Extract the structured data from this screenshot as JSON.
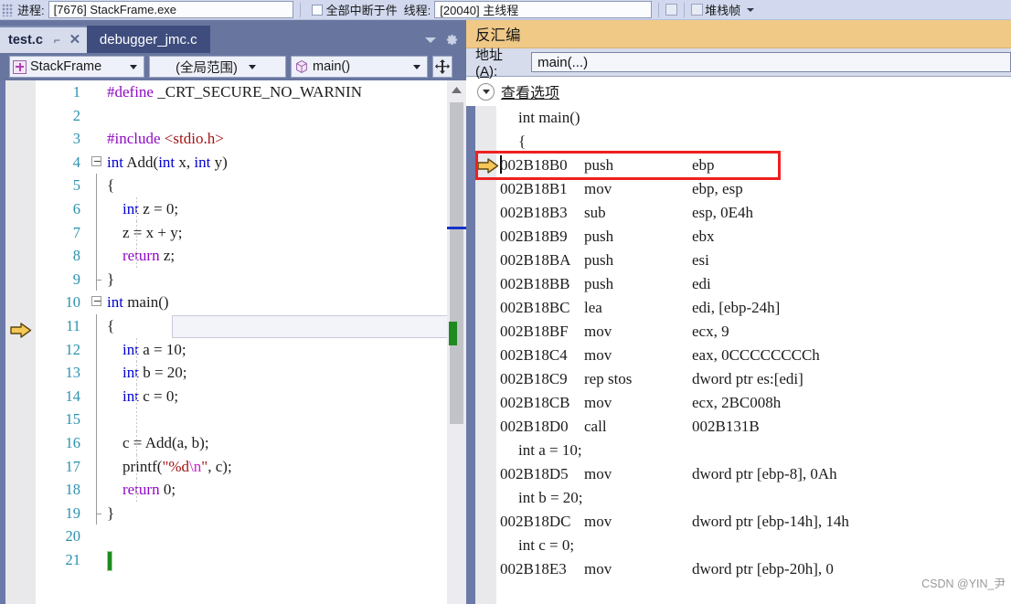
{
  "top_toolbar": {
    "process_label": "进程:",
    "process_value": "[7676] StackFrame.exe",
    "break_all_label": "全部中断于件",
    "thread_label": "线程:",
    "thread_value": "[20040] 主线程",
    "stackframe_label": "堆栈帧"
  },
  "editor": {
    "tabs": [
      {
        "name": "test.c",
        "active": true,
        "pin_icon": "pin-icon",
        "close_icon": "close-icon"
      },
      {
        "name": "debugger_jmc.c",
        "active": false
      }
    ],
    "tab_overflow_icon": "chevron-down-icon",
    "tab_settings_icon": "gear-icon",
    "navbar": {
      "project": "StackFrame",
      "scope": "(全局范围)",
      "member": "main()",
      "splitter_icon": "split-window-icon"
    },
    "current_line": 11,
    "execution_arrow_line": 11,
    "lines": [
      {
        "n": 1,
        "segments": [
          {
            "t": "#define",
            "c": "k-pre"
          },
          {
            "t": " _CRT_SECURE_NO_WARNIN",
            "c": "k-plain"
          }
        ],
        "indent": 4,
        "fold": "none"
      },
      {
        "n": 2,
        "segments": [],
        "indent": 0,
        "fold": "none"
      },
      {
        "n": 3,
        "segments": [
          {
            "t": "#include",
            "c": "k-pre"
          },
          {
            "t": " ",
            "c": "k-plain"
          },
          {
            "t": "<stdio.h>",
            "c": "k-hdr"
          }
        ],
        "indent": 3,
        "fold": "none"
      },
      {
        "n": 4,
        "segments": [
          {
            "t": "int",
            "c": "k-blue"
          },
          {
            "t": " Add(",
            "c": "k-plain"
          },
          {
            "t": "int",
            "c": "k-blue"
          },
          {
            "t": " x, ",
            "c": "k-plain"
          },
          {
            "t": "int",
            "c": "k-blue"
          },
          {
            "t": " y)",
            "c": "k-plain"
          }
        ],
        "indent": 0,
        "fold": "box"
      },
      {
        "n": 5,
        "segments": [
          {
            "t": "{",
            "c": "k-plain"
          }
        ],
        "indent": 1,
        "fold": "line"
      },
      {
        "n": 6,
        "segments": [
          {
            "t": "    ",
            "c": "k-plain"
          },
          {
            "t": "int",
            "c": "k-blue"
          },
          {
            "t": " z = ",
            "c": "k-plain"
          },
          {
            "t": "0",
            "c": "k-num"
          },
          {
            "t": ";",
            "c": "k-plain"
          }
        ],
        "indent": 1,
        "fold": "line"
      },
      {
        "n": 7,
        "segments": [
          {
            "t": "    z = x + y;",
            "c": "k-plain"
          }
        ],
        "indent": 1,
        "fold": "line"
      },
      {
        "n": 8,
        "segments": [
          {
            "t": "    ",
            "c": "k-plain"
          },
          {
            "t": "return",
            "c": "k-pre"
          },
          {
            "t": " z;",
            "c": "k-plain"
          }
        ],
        "indent": 1,
        "fold": "line"
      },
      {
        "n": 9,
        "segments": [
          {
            "t": "}",
            "c": "k-plain"
          }
        ],
        "indent": 1,
        "fold": "lineend"
      },
      {
        "n": 10,
        "segments": [
          {
            "t": "int",
            "c": "k-blue"
          },
          {
            "t": " main()",
            "c": "k-plain"
          }
        ],
        "indent": 0,
        "fold": "box"
      },
      {
        "n": 11,
        "segments": [
          {
            "t": "{",
            "c": "k-plain"
          }
        ],
        "indent": 1,
        "fold": "line"
      },
      {
        "n": 12,
        "segments": [
          {
            "t": "    ",
            "c": "k-plain"
          },
          {
            "t": "int",
            "c": "k-blue"
          },
          {
            "t": " a = ",
            "c": "k-plain"
          },
          {
            "t": "10",
            "c": "k-num"
          },
          {
            "t": ";",
            "c": "k-plain"
          }
        ],
        "indent": 1,
        "fold": "line"
      },
      {
        "n": 13,
        "segments": [
          {
            "t": "    ",
            "c": "k-plain"
          },
          {
            "t": "int",
            "c": "k-blue"
          },
          {
            "t": " b = ",
            "c": "k-plain"
          },
          {
            "t": "20",
            "c": "k-num"
          },
          {
            "t": ";",
            "c": "k-plain"
          }
        ],
        "indent": 1,
        "fold": "line"
      },
      {
        "n": 14,
        "segments": [
          {
            "t": "    ",
            "c": "k-plain"
          },
          {
            "t": "int",
            "c": "k-blue"
          },
          {
            "t": " c = ",
            "c": "k-plain"
          },
          {
            "t": "0",
            "c": "k-num"
          },
          {
            "t": ";",
            "c": "k-plain"
          }
        ],
        "indent": 1,
        "fold": "line"
      },
      {
        "n": 15,
        "segments": [],
        "indent": 1,
        "fold": "line"
      },
      {
        "n": 16,
        "segments": [
          {
            "t": "    c = Add(a, b);",
            "c": "k-plain"
          }
        ],
        "indent": 1,
        "fold": "line"
      },
      {
        "n": 17,
        "segments": [
          {
            "t": "    printf(",
            "c": "k-plain"
          },
          {
            "t": "\"%d",
            "c": "k-str"
          },
          {
            "t": "\\n",
            "c": "k-esc"
          },
          {
            "t": "\"",
            "c": "k-str"
          },
          {
            "t": ", c);",
            "c": "k-plain"
          }
        ],
        "indent": 1,
        "fold": "line"
      },
      {
        "n": 18,
        "segments": [
          {
            "t": "    ",
            "c": "k-plain"
          },
          {
            "t": "return",
            "c": "k-pre"
          },
          {
            "t": " ",
            "c": "k-plain"
          },
          {
            "t": "0",
            "c": "k-num"
          },
          {
            "t": ";",
            "c": "k-plain"
          }
        ],
        "indent": 1,
        "fold": "line"
      },
      {
        "n": 19,
        "segments": [
          {
            "t": "}",
            "c": "k-plain"
          }
        ],
        "indent": 1,
        "fold": "lineend"
      },
      {
        "n": 20,
        "segments": [],
        "indent": 0,
        "fold": "none"
      },
      {
        "n": 21,
        "segments": [],
        "indent": 0,
        "fold": "none"
      }
    ]
  },
  "disassembly": {
    "title": "反汇编",
    "address_label_prefix": "地址(",
    "address_label_key": "A",
    "address_label_suffix": "):",
    "address_value": "main(...)",
    "view_options_label": "查看选项",
    "execution_arrow_index": 2,
    "rows": [
      {
        "kind": "source",
        "src": "int main()"
      },
      {
        "kind": "source",
        "src": "{"
      },
      {
        "kind": "asm",
        "addr": "002B18B0",
        "mnem": "push",
        "ops": "ebp",
        "highlight": true,
        "current": true
      },
      {
        "kind": "asm",
        "addr": "002B18B1",
        "mnem": "mov",
        "ops": "ebp, esp"
      },
      {
        "kind": "asm",
        "addr": "002B18B3",
        "mnem": "sub",
        "ops": "esp, 0E4h"
      },
      {
        "kind": "asm",
        "addr": "002B18B9",
        "mnem": "push",
        "ops": "ebx"
      },
      {
        "kind": "asm",
        "addr": "002B18BA",
        "mnem": "push",
        "ops": "esi"
      },
      {
        "kind": "asm",
        "addr": "002B18BB",
        "mnem": "push",
        "ops": "edi"
      },
      {
        "kind": "asm",
        "addr": "002B18BC",
        "mnem": "lea",
        "ops": "edi, [ebp-24h]"
      },
      {
        "kind": "asm",
        "addr": "002B18BF",
        "mnem": "mov",
        "ops": "ecx, 9"
      },
      {
        "kind": "asm",
        "addr": "002B18C4",
        "mnem": "mov",
        "ops": "eax, 0CCCCCCCCh"
      },
      {
        "kind": "asm",
        "addr": "002B18C9",
        "mnem": "rep stos",
        "ops": "dword ptr es:[edi]"
      },
      {
        "kind": "asm",
        "addr": "002B18CB",
        "mnem": "mov",
        "ops": "ecx, 2BC008h"
      },
      {
        "kind": "asm",
        "addr": "002B18D0",
        "mnem": "call",
        "ops": "002B131B"
      },
      {
        "kind": "source",
        "src": "int a = 10;"
      },
      {
        "kind": "asm",
        "addr": "002B18D5",
        "mnem": "mov",
        "ops": "dword ptr [ebp-8], 0Ah"
      },
      {
        "kind": "source",
        "src": "int b = 20;"
      },
      {
        "kind": "asm",
        "addr": "002B18DC",
        "mnem": "mov",
        "ops": "dword ptr [ebp-14h], 14h"
      },
      {
        "kind": "source",
        "src": "int c = 0;"
      },
      {
        "kind": "asm",
        "addr": "002B18E3",
        "mnem": "mov",
        "ops": "dword ptr [ebp-20h], 0"
      }
    ]
  },
  "watermark": "CSDN @YIN_尹",
  "colors": {
    "chrome_blue": "#68769f",
    "tab_active_bg": "#d6dcec",
    "tab_inactive_bg": "#3f4d7e",
    "disasm_title_bg": "#f0c987",
    "highlight_red": "#ef2020",
    "marker_green": "#1f8a1f",
    "line_number": "#2b91af",
    "keyword_blue": "#0000d4",
    "keyword_purple": "#8f08c4",
    "string_red": "#a31515"
  }
}
